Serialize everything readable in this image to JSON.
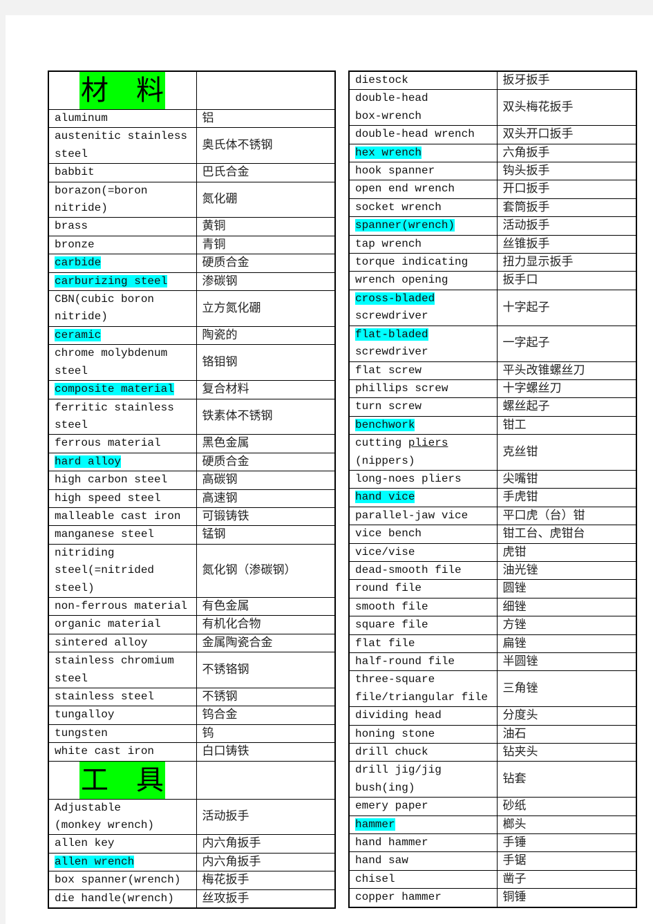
{
  "left_table": [
    {
      "header": "材　料"
    },
    {
      "en": [
        "aluminum"
      ],
      "zh": "铝"
    },
    {
      "en": [
        "austenitic stainless",
        "steel"
      ],
      "zh": "奥氏体不锈钢"
    },
    {
      "en": [
        "babbit"
      ],
      "zh": "巴氏合金"
    },
    {
      "en": [
        "borazon(=boron",
        "nitride)"
      ],
      "zh": "氮化硼"
    },
    {
      "en": [
        "brass"
      ],
      "zh": "黄铜"
    },
    {
      "en": [
        "bronze"
      ],
      "zh": "青铜"
    },
    {
      "en": [
        "carbide"
      ],
      "zh": "硬质合金",
      "hl": true
    },
    {
      "en": [
        "carburizing steel"
      ],
      "zh": "渗碳钢",
      "hl": true
    },
    {
      "en": [
        "CBN(cubic boron",
        "nitride)"
      ],
      "zh": "立方氮化硼"
    },
    {
      "en": [
        "ceramic"
      ],
      "zh": "陶瓷的",
      "hl": true
    },
    {
      "en": [
        "chrome molybdenum",
        "steel"
      ],
      "zh": "铬钼钢"
    },
    {
      "en": [
        "composite material"
      ],
      "zh": "复合材料",
      "hl": true
    },
    {
      "en": [
        "ferritic stainless",
        "steel"
      ],
      "zh": "铁素体不锈钢"
    },
    {
      "en": [
        "ferrous material"
      ],
      "zh": "黑色金属"
    },
    {
      "en": [
        "hard alloy"
      ],
      "zh": "硬质合金",
      "hl": true
    },
    {
      "en": [
        "high carbon steel"
      ],
      "zh": "高碳钢"
    },
    {
      "en": [
        "high speed steel"
      ],
      "zh": "高速钢"
    },
    {
      "en": [
        "malleable cast iron"
      ],
      "zh": "可锻铸铁"
    },
    {
      "en": [
        "manganese steel"
      ],
      "zh": "锰钢"
    },
    {
      "en": [
        "nitriding",
        "steel(=nitrided",
        "steel)"
      ],
      "zh": "氮化钢（渗碳钢）"
    },
    {
      "en": [
        "non-ferrous material"
      ],
      "zh": "有色金属"
    },
    {
      "en": [
        "organic material"
      ],
      "zh": "有机化合物"
    },
    {
      "en": [
        "sintered alloy"
      ],
      "zh": "金属陶瓷合金"
    },
    {
      "en": [
        "stainless chromium",
        "steel"
      ],
      "zh": "不锈铬钢"
    },
    {
      "en": [
        "stainless steel"
      ],
      "zh": "不锈钢"
    },
    {
      "en": [
        "tungalloy"
      ],
      "zh": "钨合金"
    },
    {
      "en": [
        "tungsten"
      ],
      "zh": "钨"
    },
    {
      "en": [
        "white cast iron"
      ],
      "zh": "白口铸铁"
    },
    {
      "header": "工　具"
    },
    {
      "en": [
        "Adjustable",
        "(monkey wrench)"
      ],
      "zh": "活动扳手"
    },
    {
      "en": [
        "allen key"
      ],
      "zh": "内六角扳手"
    },
    {
      "en": [
        "allen wrench"
      ],
      "zh": "内六角扳手",
      "hl": true
    },
    {
      "en": [
        "box spanner(wrench)"
      ],
      "zh": "梅花扳手"
    },
    {
      "en": [
        "die handle(wrench)"
      ],
      "zh": "丝攻扳手"
    }
  ],
  "right_table": [
    {
      "en": [
        "diestock"
      ],
      "zh": "扳牙扳手"
    },
    {
      "en": [
        "double-head",
        "box-wrench"
      ],
      "zh": "双头梅花扳手"
    },
    {
      "en": [
        "double-head wrench"
      ],
      "zh": "双头开口扳手"
    },
    {
      "en": [
        "hex wrench"
      ],
      "zh": "六角扳手",
      "hl": true
    },
    {
      "en": [
        "hook spanner"
      ],
      "zh": "钩头扳手"
    },
    {
      "en": [
        "open end wrench"
      ],
      "zh": "开口扳手"
    },
    {
      "en": [
        "socket wrench"
      ],
      "zh": "套筒扳手"
    },
    {
      "en": [
        "spanner(wrench)"
      ],
      "zh": "活动扳手",
      "hl": true
    },
    {
      "en": [
        "tap wrench"
      ],
      "zh": "丝锥扳手"
    },
    {
      "en": [
        "torque indicating"
      ],
      "zh": "扭力显示扳手"
    },
    {
      "en": [
        "wrench opening"
      ],
      "zh": "扳手口"
    },
    {
      "en": [
        "cross-bladed ",
        "screwdriver"
      ],
      "zh": "十字起子",
      "hl": true
    },
    {
      "en": [
        "flat-bladed",
        "screwdriver"
      ],
      "zh": "一字起子",
      "hl": true
    },
    {
      "en": [
        "flat screw"
      ],
      "zh": "平头改锥螺丝刀"
    },
    {
      "en": [
        "phillips screw"
      ],
      "zh": "十字螺丝刀"
    },
    {
      "en": [
        "turn screw"
      ],
      "zh": "螺丝起子"
    },
    {
      "en": [
        "benchwork"
      ],
      "zh": "钳工",
      "hl": true
    },
    {
      "en": [
        "cutting pliers",
        "(nippers)"
      ],
      "zh": "克丝钳",
      "underline": "pliers"
    },
    {
      "en": [
        "long-noes pliers"
      ],
      "zh": "尖嘴钳"
    },
    {
      "en": [
        "hand vice"
      ],
      "zh": "手虎钳",
      "hl": true
    },
    {
      "en": [
        "parallel-jaw vice"
      ],
      "zh": "平口虎（台）钳"
    },
    {
      "en": [
        "vice bench"
      ],
      "zh": "钳工台、虎钳台"
    },
    {
      "en": [
        "vice/vise"
      ],
      "zh": "虎钳"
    },
    {
      "en": [
        "dead-smooth file"
      ],
      "zh": "油光锉"
    },
    {
      "en": [
        "round file"
      ],
      "zh": "圆锉"
    },
    {
      "en": [
        "smooth file"
      ],
      "zh": "细锉"
    },
    {
      "en": [
        "square file"
      ],
      "zh": "方锉"
    },
    {
      "en": [
        "flat file"
      ],
      "zh": "扁锉"
    },
    {
      "en": [
        "half-round file"
      ],
      "zh": "半圆锉"
    },
    {
      "en": [
        "three-square",
        "file/triangular file"
      ],
      "zh": "三角锉"
    },
    {
      "en": [
        "dividing head"
      ],
      "zh": "分度头"
    },
    {
      "en": [
        "honing stone"
      ],
      "zh": "油石"
    },
    {
      "en": [
        "drill chuck"
      ],
      "zh": "钻夹头"
    },
    {
      "en": [
        "drill jig/jig",
        "bush(ing)"
      ],
      "zh": "钻套"
    },
    {
      "en": [
        "emery paper"
      ],
      "zh": "砂纸"
    },
    {
      "en": [
        "hammer"
      ],
      "zh": "榔头",
      "hl": true
    },
    {
      "en": [
        "hand hammer"
      ],
      "zh": "手锤"
    },
    {
      "en": [
        "hand saw"
      ],
      "zh": "手锯"
    },
    {
      "en": [
        "chisel"
      ],
      "zh": "凿子"
    },
    {
      "en": [
        "copper hammer"
      ],
      "zh": "铜锤"
    }
  ],
  "colors": {
    "header_highlight": "#00ff00",
    "term_highlight": "#00ffff"
  }
}
